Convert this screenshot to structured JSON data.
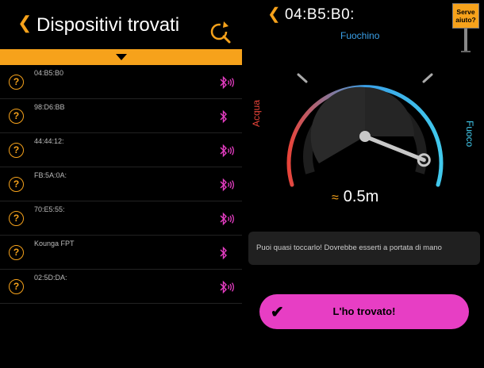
{
  "left": {
    "title": "Dispositivi trovati",
    "back_icon": "chevron-left-icon",
    "refresh_icon": "search-refresh-icon",
    "accent_color": "#f6a21b",
    "devices": [
      {
        "address": "04:B5:B0",
        "icon": "bluetooth-signal-icon"
      },
      {
        "address": "98:D6:BB",
        "icon": "bluetooth-icon"
      },
      {
        "address": "44:44:12:",
        "icon": "bluetooth-signal-icon"
      },
      {
        "address": "FB:5A:0A:",
        "icon": "bluetooth-signal-icon"
      },
      {
        "address": "70:E5:55:",
        "icon": "bluetooth-signal-icon"
      },
      {
        "address": "Kounga FPT",
        "icon": "bluetooth-icon"
      },
      {
        "address": "02:5D:DA:",
        "icon": "bluetooth-signal-icon"
      }
    ],
    "unknown_icon": "question-mark-icon",
    "question_mark": "?"
  },
  "right": {
    "back_icon": "chevron-left-icon",
    "title": "04:B5:B0:",
    "help_label": "Serve aiuto?",
    "gauge": {
      "label_top": "Fuochino",
      "label_left": "Acqua",
      "label_right": "Fuoco",
      "level": 0.93,
      "colors": {
        "cold": "#e8443a",
        "mid": "#3aa0e8",
        "hot": "#41c9ec"
      }
    },
    "distance_prefix": "≈",
    "distance": "0.5m",
    "message": "Puoi quasi toccarlo! Dovrebbe esserti a portata di mano",
    "found_button": "L'ho trovato!",
    "found_button_color": "#e73ec4",
    "check_icon": "checkmark-icon"
  }
}
